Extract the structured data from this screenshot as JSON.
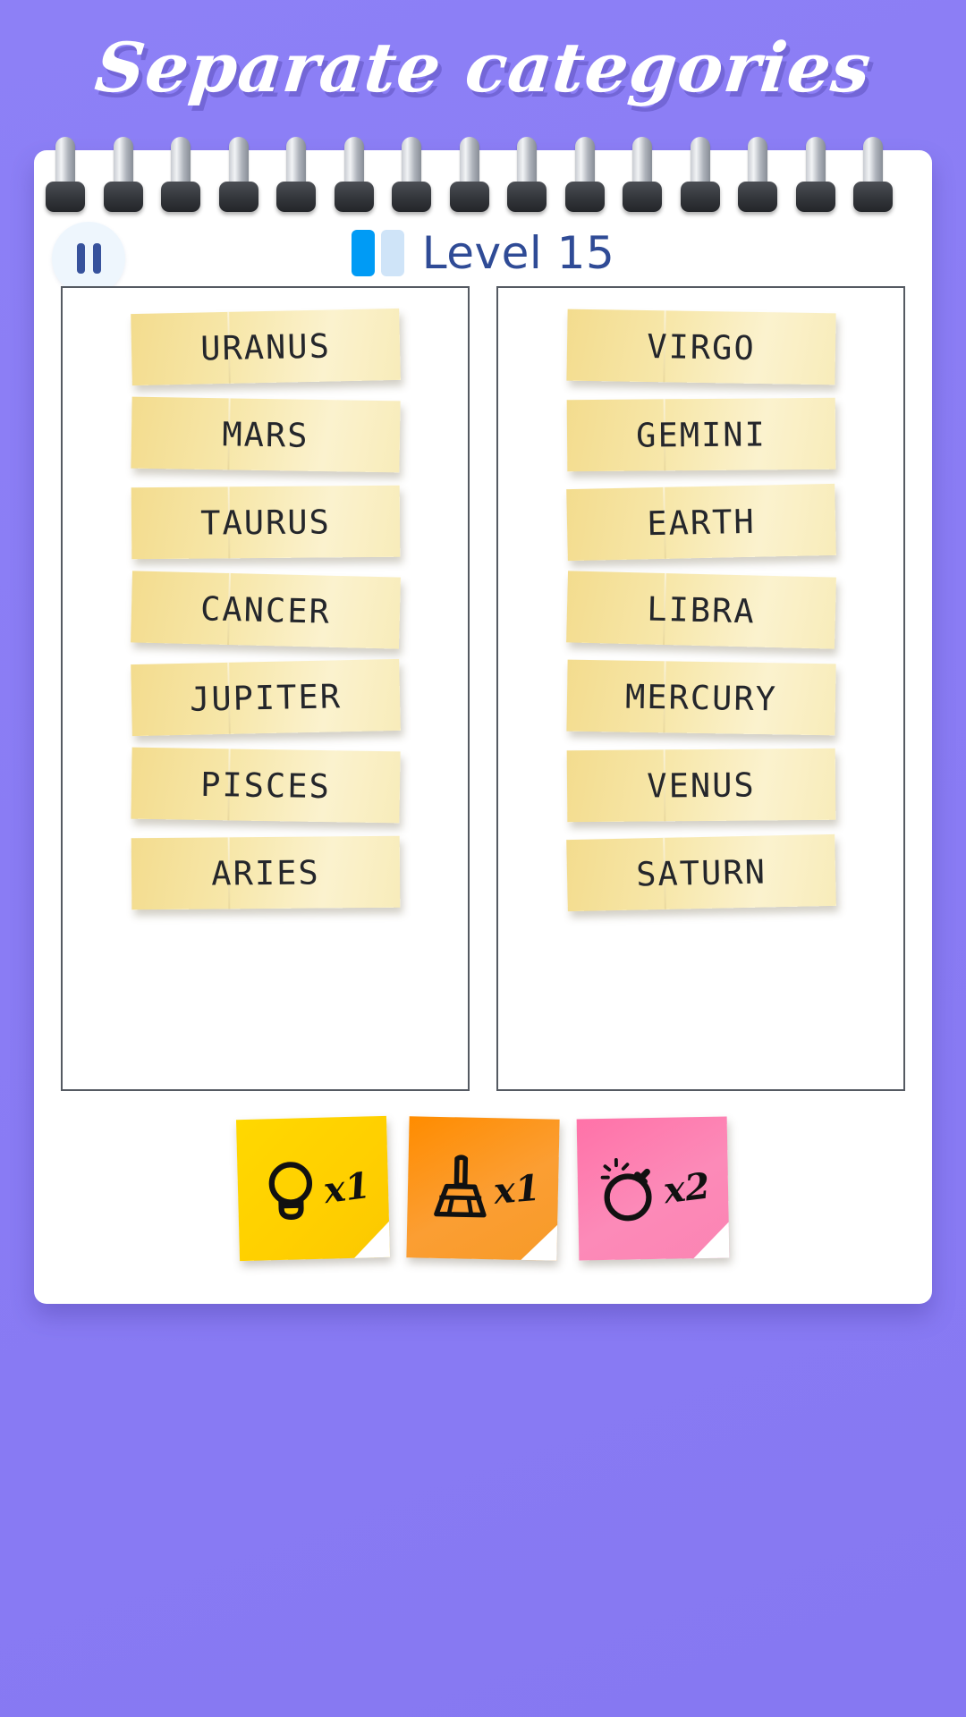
{
  "page_title": "Separate categories",
  "header": {
    "pause_label": "Pause",
    "level_label": "Level 15",
    "progress": {
      "filled": 1,
      "total": 2,
      "filled_color": "#009bf5",
      "empty_color": "#cfe4f8"
    },
    "level_text_color": "#2f4b96"
  },
  "theme": {
    "background": "#8b7ef5",
    "page": "#ffffff",
    "note": "#f5e6a6",
    "note_text": "#24262b",
    "column_border": "#555a62"
  },
  "columns": [
    {
      "name": "left-column",
      "notes": [
        {
          "label": "URANUS"
        },
        {
          "label": "MARS"
        },
        {
          "label": "TAURUS"
        },
        {
          "label": "CANCER"
        },
        {
          "label": "JUPITER"
        },
        {
          "label": "PISCES"
        },
        {
          "label": "ARIES"
        }
      ]
    },
    {
      "name": "right-column",
      "notes": [
        {
          "label": "VIRGO"
        },
        {
          "label": "GEMINI"
        },
        {
          "label": "EARTH"
        },
        {
          "label": "LIBRA"
        },
        {
          "label": "MERCURY"
        },
        {
          "label": "VENUS"
        },
        {
          "label": "SATURN"
        }
      ]
    }
  ],
  "powerups": [
    {
      "name": "hint",
      "icon": "lightbulb-icon",
      "count": "x1",
      "color": "#ffd800"
    },
    {
      "name": "clean",
      "icon": "broom-icon",
      "count": "x1",
      "color": "#ff8c00"
    },
    {
      "name": "bomb",
      "icon": "bomb-icon",
      "count": "x2",
      "color": "#ff72a8"
    }
  ]
}
